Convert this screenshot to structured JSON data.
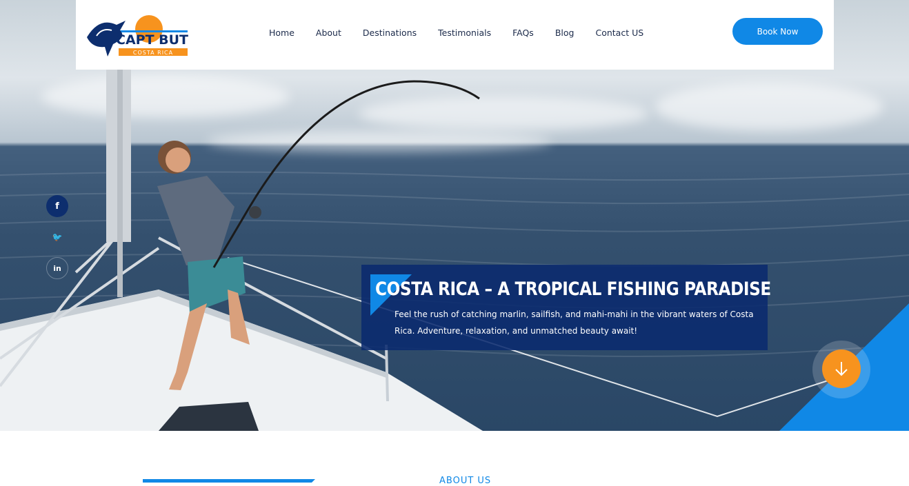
{
  "brand": {
    "name": "CAPT BUTCH",
    "tagline": "COSTA RICA",
    "colors": {
      "navy": "#0d2e6e",
      "blue": "#1088e6",
      "orange": "#f7931e"
    }
  },
  "nav": {
    "items": [
      "Home",
      "About",
      "Destinations",
      "Testimonials",
      "FAQs",
      "Blog",
      "Contact US"
    ]
  },
  "header": {
    "book_label": "Book Now"
  },
  "social": {
    "icons": [
      "facebook-icon",
      "twitter-icon",
      "linkedin-icon"
    ],
    "fb": "f",
    "tw": "🐦",
    "li": "in"
  },
  "hero": {
    "title": "COSTA RICA – A TROPICAL FISHING PARADISE",
    "subtitle": "Feel the rush of catching marlin, sailfish, and mahi-mahi in the vibrant waters of Costa Rica. Adventure, relaxation, and unmatched beauty await!",
    "scroll_icon": "arrow-down-icon"
  },
  "about": {
    "label": "ABOUT US"
  }
}
